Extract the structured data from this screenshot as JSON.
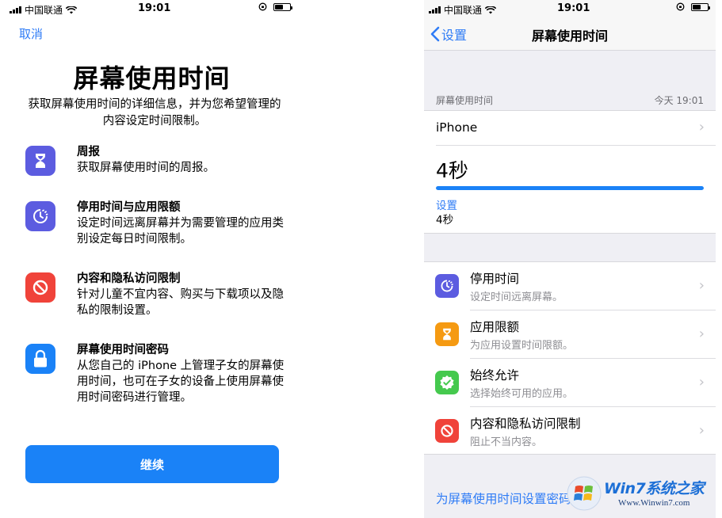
{
  "status_bar": {
    "carrier": "中国联通",
    "time": "19:01"
  },
  "left": {
    "cancel_label": "取消",
    "title": "屏幕使用时间",
    "intro": "获取屏幕使用时间的详细信息，并为您希望管理的内容设定时间限制。",
    "features": [
      {
        "name": "周报",
        "desc": "获取屏幕使用时间的周报。",
        "icon": "hourglass-icon",
        "color": "#5c5ce0"
      },
      {
        "name": "停用时间与应用限额",
        "desc": "设定时间远离屏幕并为需要管理的应用类别设定每日时间限制。",
        "icon": "downtime-icon",
        "color": "#5c5ce0"
      },
      {
        "name": "内容和隐私访问限制",
        "desc": "针对儿童不宜内容、购买与下载项以及隐私的限制设置。",
        "icon": "restriction-icon",
        "color": "#f0433a"
      },
      {
        "name": "屏幕使用时间密码",
        "desc": "从您自己的 iPhone 上管理子女的屏幕使用时间，也可在子女的设备上使用屏幕使用时间密码进行管理。",
        "icon": "lock-icon",
        "color": "#1a82f7"
      }
    ],
    "continue_label": "继续"
  },
  "right": {
    "back_label": "设置",
    "nav_title": "屏幕使用时间",
    "section_label": "屏幕使用时间",
    "section_time": "今天 19:01",
    "device_name": "iPhone",
    "total_usage": "4秒",
    "usage_fraction": 1.0,
    "category_label": "设置",
    "category_time": "4秒",
    "rows": [
      {
        "title": "停用时间",
        "subtitle": "设定时间远离屏幕。",
        "icon": "downtime-icon",
        "color": "#5c5ce0"
      },
      {
        "title": "应用限额",
        "subtitle": "为应用设置时间限额。",
        "icon": "hourglass-icon",
        "color": "#f59a12"
      },
      {
        "title": "始终允许",
        "subtitle": "选择始终可用的应用。",
        "icon": "check-badge-icon",
        "color": "#45c94e"
      },
      {
        "title": "内容和隐私访问限制",
        "subtitle": "阻止不当内容。",
        "icon": "restriction-icon",
        "color": "#f0433a"
      }
    ],
    "passcode_link": "为屏幕使用时间设置密码"
  },
  "watermark": {
    "brand": "Win7系统之家",
    "url": "Www.Winwin7.com"
  },
  "colors": {
    "accent": "#1a82f7",
    "link": "#2f7cf6"
  }
}
